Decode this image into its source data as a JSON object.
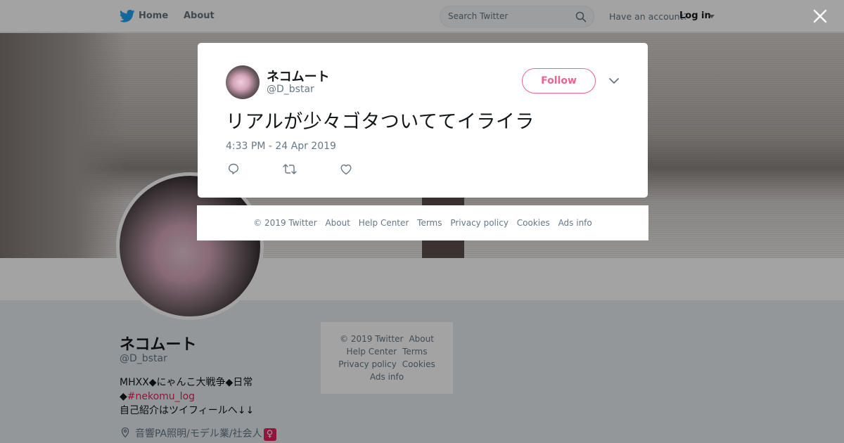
{
  "nav": {
    "home_label": "Home",
    "about_label": "About",
    "search_placeholder": "Search Twitter",
    "have_account_label": "Have an account?",
    "login_label": "Log in"
  },
  "profile": {
    "name": "ネコムート",
    "handle": "@D_bstar",
    "bio_line1": "MHXX◆にゃんこ大戦争◆日常",
    "bio_line2_prefix": "◆",
    "bio_hashtag": "#nekomu_log",
    "bio_line3": "自己紹介はツイフィールへ↓↓",
    "location": "音響PA照明/モデル業/社会人",
    "location_emoji": "♀"
  },
  "side_footer": {
    "copyright": "© 2019 Twitter",
    "about": "About",
    "help_center": "Help Center",
    "terms": "Terms",
    "privacy_policy": "Privacy policy",
    "cookies": "Cookies",
    "ads_info": "Ads info"
  },
  "tweet": {
    "author_name": "ネコムート",
    "author_handle": "@D_bstar",
    "follow_label": "Follow",
    "text": "リアルが少々ゴタついててイライラ",
    "timestamp": "4:33 PM - 24 Apr 2019"
  },
  "modal_footer": {
    "copyright": "© 2019 Twitter",
    "about": "About",
    "help_center": "Help Center",
    "terms": "Terms",
    "privacy_policy": "Privacy policy",
    "cookies": "Cookies",
    "ads_info": "Ads info"
  },
  "colors": {
    "twitter_blue": "#1da1f2",
    "accent_pink": "#e0245e",
    "muted_text": "#657786"
  }
}
